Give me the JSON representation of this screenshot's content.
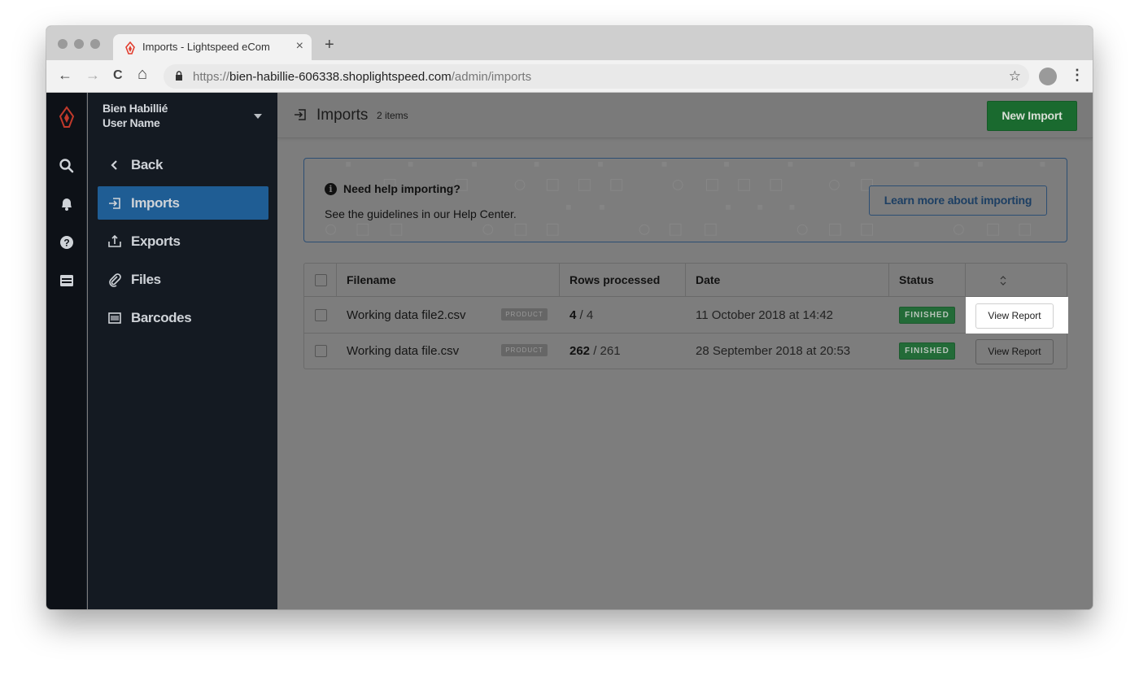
{
  "browser": {
    "tab_title": "Imports - Lightspeed eCom",
    "tab_close": "×",
    "new_tab": "+",
    "back": "←",
    "forward": "→",
    "reload": "C",
    "home": "⌂",
    "url_scheme": "https://",
    "url_host": "bien-habillie-606338.shoplightspeed.com",
    "url_path": "/admin/imports",
    "bookmark_star": "☆",
    "menu": "⋮"
  },
  "sidebar": {
    "store_name": "Bien Habillié",
    "user_name": "User Name",
    "items": [
      {
        "label": "Back",
        "icon": "chevron-left-icon",
        "glyph": "‹"
      },
      {
        "label": "Imports",
        "icon": "import-icon",
        "glyph": "⇥",
        "active": true
      },
      {
        "label": "Exports",
        "icon": "export-icon",
        "glyph": "⇪"
      },
      {
        "label": "Files",
        "icon": "paperclip-icon",
        "glyph": "⌇"
      },
      {
        "label": "Barcodes",
        "icon": "barcode-icon",
        "glyph": "▥"
      }
    ]
  },
  "rail": {
    "icons": [
      "lightspeed-logo-icon",
      "search-icon",
      "bell-icon",
      "help-icon",
      "store-icon"
    ]
  },
  "header": {
    "title": "Imports",
    "count": "2 items",
    "new_import_label": "New Import"
  },
  "help": {
    "title": "Need help importing?",
    "subtitle": "See the guidelines in our Help Center.",
    "learn_more_label": "Learn more about importing"
  },
  "table": {
    "columns": [
      "Filename",
      "Rows processed",
      "Date",
      "Status"
    ],
    "rows": [
      {
        "filename": "Working data file2.csv",
        "type": "PRODUCT",
        "rows_done": "4",
        "rows_total": " / 4",
        "date": "11 October 2018 at 14:42",
        "status": "FINISHED",
        "action": "View Report"
      },
      {
        "filename": "Working data file.csv",
        "type": "PRODUCT",
        "rows_done": "262",
        "rows_total": " / 261",
        "date": "28 September 2018 at 20:53",
        "status": "FINISHED",
        "action": "View Report"
      }
    ]
  },
  "colors": {
    "accent_green": "#1a6a2f",
    "nav_active": "#1f5d94",
    "brand_red": "#e23d2e"
  }
}
